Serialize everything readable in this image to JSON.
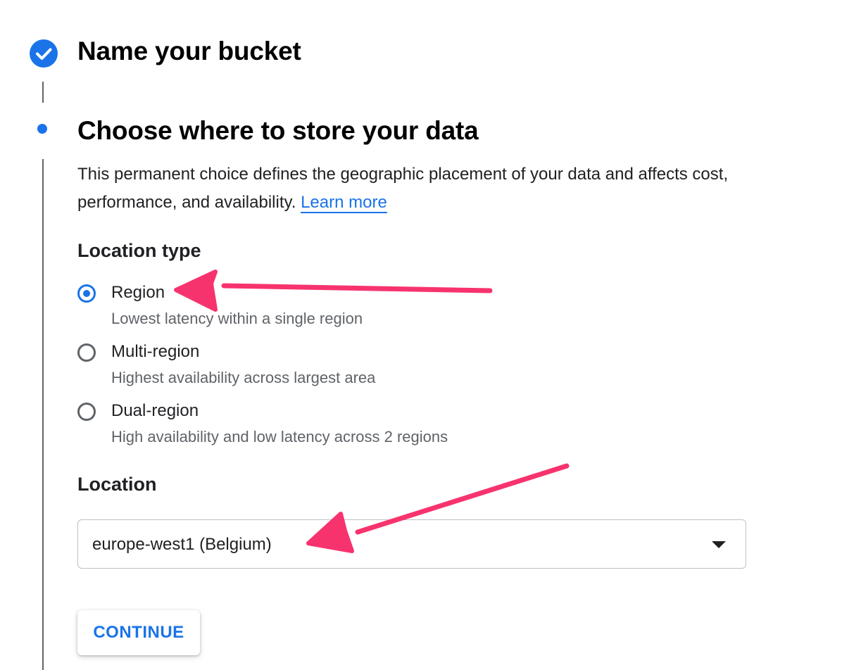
{
  "stepper": {
    "steps": [
      {
        "title": "Name your bucket",
        "state": "completed",
        "icon": "check-circle-icon"
      },
      {
        "title": "Choose where to store your data",
        "state": "active"
      }
    ]
  },
  "description": {
    "text": "This permanent choice defines the geographic placement of your data and affects cost, performance, and availability.",
    "link_label": "Learn more"
  },
  "location_type": {
    "heading": "Location type",
    "options": [
      {
        "label": "Region",
        "description": "Lowest latency within a single region",
        "selected": true
      },
      {
        "label": "Multi-region",
        "description": "Highest availability across largest area",
        "selected": false
      },
      {
        "label": "Dual-region",
        "description": "High availability and low latency across 2 regions",
        "selected": false
      }
    ]
  },
  "location": {
    "heading": "Location",
    "selected_value": "europe-west1 (Belgium)",
    "icon": "dropdown-arrow-icon"
  },
  "actions": {
    "continue_label": "CONTINUE"
  },
  "colors": {
    "accent": "#1a73e8",
    "annotation_arrow": "#f7336e",
    "text": "#202124",
    "secondary_text": "#5f6368"
  },
  "annotations": {
    "arrows": [
      "pointing-to-region-option",
      "pointing-to-location-select"
    ]
  }
}
